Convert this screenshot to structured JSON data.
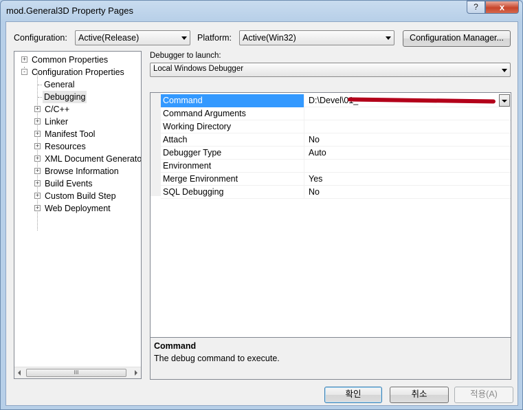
{
  "window": {
    "title": "mod.General3D Property Pages",
    "help_label": "?",
    "close_label": "x"
  },
  "toolbar": {
    "configuration_label": "Configuration:",
    "configuration_value": "Active(Release)",
    "platform_label": "Platform:",
    "platform_value": "Active(Win32)",
    "config_manager_label": "Configuration Manager..."
  },
  "tree": {
    "items": [
      {
        "label": "Common Properties",
        "expander": "+"
      },
      {
        "label": "Configuration Properties",
        "expander": "-"
      },
      {
        "label": "General"
      },
      {
        "label": "Debugging"
      },
      {
        "label": "C/C++",
        "expander": "+"
      },
      {
        "label": "Linker",
        "expander": "+"
      },
      {
        "label": "Manifest Tool",
        "expander": "+"
      },
      {
        "label": "Resources",
        "expander": "+"
      },
      {
        "label": "XML Document Generator",
        "expander": "+"
      },
      {
        "label": "Browse Information",
        "expander": "+"
      },
      {
        "label": "Build Events",
        "expander": "+"
      },
      {
        "label": "Custom Build Step",
        "expander": "+"
      },
      {
        "label": "Web Deployment",
        "expander": "+"
      }
    ],
    "scroll_grip": "III"
  },
  "debugger": {
    "label": "Debugger to launch:",
    "value": "Local Windows Debugger"
  },
  "properties": [
    {
      "name": "Command",
      "value": "D:\\Devel\\01_"
    },
    {
      "name": "Command Arguments",
      "value": ""
    },
    {
      "name": "Working Directory",
      "value": ""
    },
    {
      "name": "Attach",
      "value": "No"
    },
    {
      "name": "Debugger Type",
      "value": "Auto"
    },
    {
      "name": "Environment",
      "value": ""
    },
    {
      "name": "Merge Environment",
      "value": "Yes"
    },
    {
      "name": "SQL Debugging",
      "value": "No"
    }
  ],
  "description": {
    "title": "Command",
    "text": "The debug command to execute."
  },
  "buttons": {
    "ok": "확인",
    "cancel": "취소",
    "apply": "적용(A)"
  },
  "colors": {
    "selection": "#3399ff",
    "redaction": "#b3001a"
  }
}
